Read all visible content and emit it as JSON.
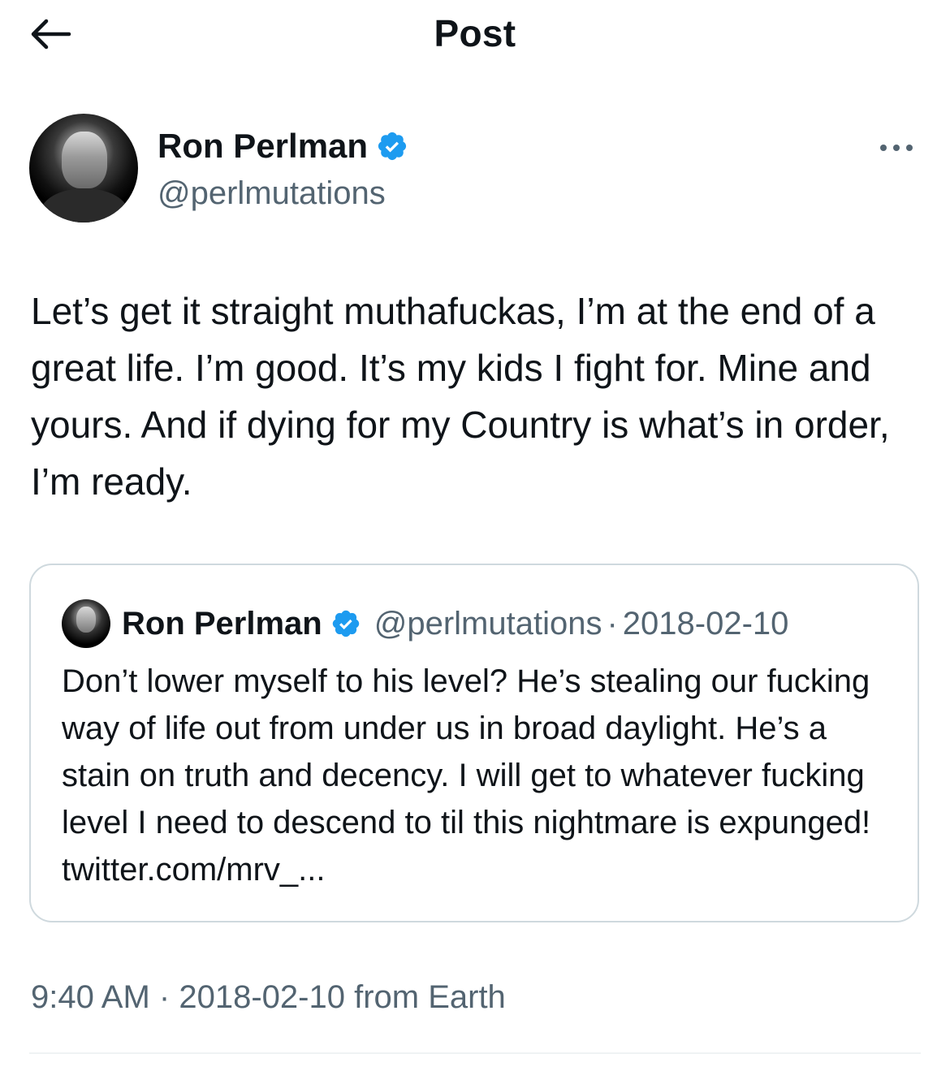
{
  "header": {
    "title": "Post",
    "back_icon": "arrow-left-icon"
  },
  "post": {
    "author_name": "Ron Perlman",
    "author_handle": "@perlmutations",
    "verified_icon": "verified-badge-icon",
    "verified_color": "#1d9bf0",
    "more_icon": "more-horizontal-icon",
    "text": "Let’s get it straight muthafuckas, I’m at the end of a great life. I’m good. It’s my kids I fight for. Mine and yours. And if dying for my Country is what’s in order, I’m ready.",
    "timestamp": "9:40 AM",
    "date": "2018-02-10",
    "location": "from Earth",
    "separator": "·"
  },
  "quote": {
    "author_name": "Ron Perlman",
    "author_handle": "@perlmutations",
    "separator": "·",
    "date": "2018-02-10",
    "text": "Don’t lower myself to his level? He’s stealing our fucking way of life out from under us in broad daylight. He’s a stain on truth and decency. I will get to whatever fucking level I need to descend to til this nightmare is expunged! twitter.com/mrv_..."
  },
  "colors": {
    "text_primary": "#0f1419",
    "text_secondary": "#536471",
    "border": "#cfd9de"
  }
}
